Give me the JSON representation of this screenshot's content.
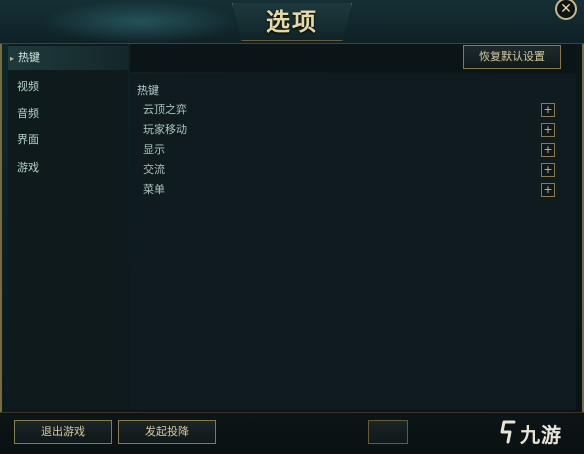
{
  "title": "选项",
  "close_icon": "close-icon",
  "sidebar": {
    "items": [
      {
        "label": "热键",
        "active": true
      },
      {
        "label": "视频",
        "active": false
      },
      {
        "label": "音频",
        "active": false
      },
      {
        "label": "界面",
        "active": false
      },
      {
        "label": "游戏",
        "active": false
      }
    ]
  },
  "toolbar": {
    "restore_label": "恢复默认设置"
  },
  "content": {
    "section_title": "热键",
    "rows": [
      {
        "label": "云顶之弈"
      },
      {
        "label": "玩家移动"
      },
      {
        "label": "显示"
      },
      {
        "label": "交流"
      },
      {
        "label": "菜单"
      }
    ],
    "expand_icon": "plus-icon"
  },
  "footer": {
    "exit_label": "退出游戏",
    "surrender_label": "发起投降"
  },
  "watermark": {
    "text": "九游"
  },
  "colors": {
    "accent_gold": "#c8b88a",
    "panel": "#0f1b1e",
    "frame_border": "#7a6a3e"
  }
}
